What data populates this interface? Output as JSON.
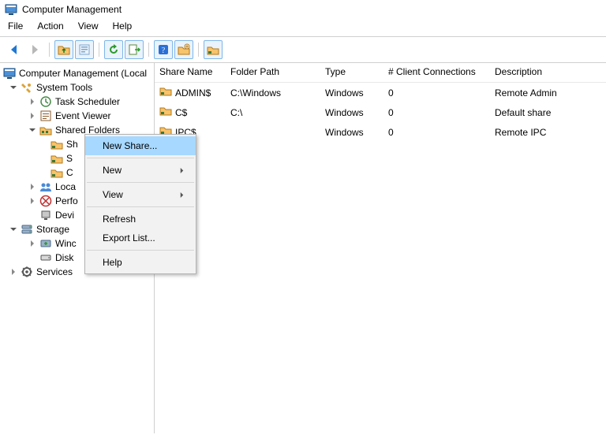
{
  "window": {
    "title": "Computer Management"
  },
  "menu": {
    "file": "File",
    "action": "Action",
    "view": "View",
    "help": "Help"
  },
  "tree": {
    "root": "Computer Management (Local",
    "systemTools": "System Tools",
    "taskScheduler": "Task Scheduler",
    "eventViewer": "Event Viewer",
    "sharedFolders": "Shared Folders",
    "shares_cut": "Sh",
    "s_cut": "S",
    "c_cut": "C",
    "localUsers_cut": "Loca",
    "performance_cut": "Perfo",
    "deviceMgr_cut": "Devi",
    "storage": "Storage",
    "winBackup_cut": "Winc",
    "diskMgmt_cut": "Disk",
    "services_cut": "Services"
  },
  "list": {
    "headers": {
      "shareName": "Share Name",
      "folderPath": "Folder Path",
      "type": "Type",
      "clientConn": "# Client Connections",
      "description": "Description"
    },
    "rows": [
      {
        "name": "ADMIN$",
        "path": "C:\\Windows",
        "type": "Windows",
        "conn": "0",
        "desc": "Remote Admin"
      },
      {
        "name": "C$",
        "path": "C:\\",
        "type": "Windows",
        "conn": "0",
        "desc": "Default share"
      },
      {
        "name": "IPC$",
        "path": "",
        "type": "Windows",
        "conn": "0",
        "desc": "Remote IPC"
      }
    ]
  },
  "ctx": {
    "newShare": "New Share...",
    "new": "New",
    "view": "View",
    "refresh": "Refresh",
    "exportList": "Export List...",
    "help": "Help"
  }
}
